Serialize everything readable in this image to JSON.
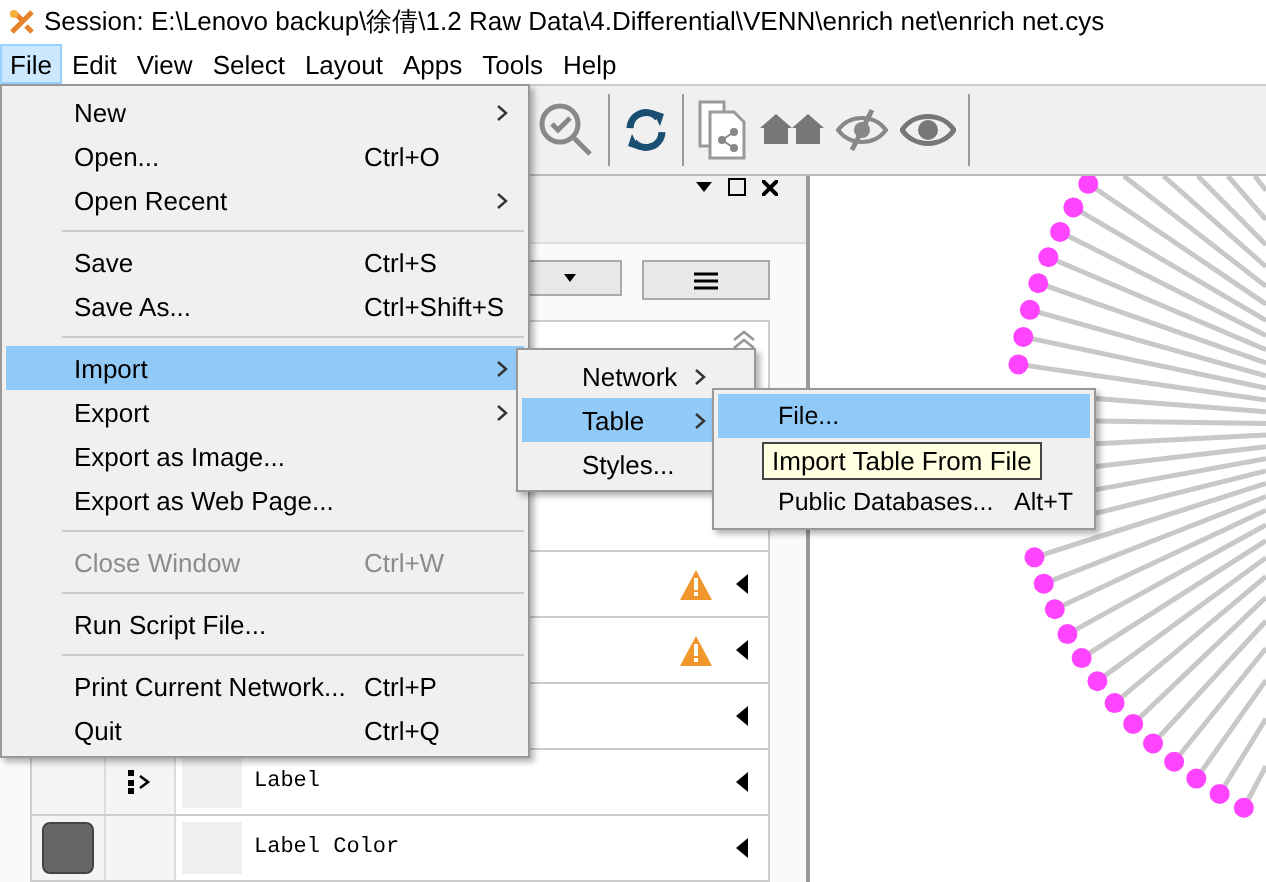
{
  "window": {
    "title": "Session: E:\\Lenovo backup\\徐倩\\1.2 Raw Data\\4.Differential\\VENN\\enrich net\\enrich net.cys"
  },
  "menubar": [
    {
      "label": "File",
      "selected": true
    },
    {
      "label": "Edit",
      "selected": false
    },
    {
      "label": "View",
      "selected": false
    },
    {
      "label": "Select",
      "selected": false
    },
    {
      "label": "Layout",
      "selected": false
    },
    {
      "label": "Apps",
      "selected": false
    },
    {
      "label": "Tools",
      "selected": false
    },
    {
      "label": "Help",
      "selected": false
    }
  ],
  "file_menu": {
    "groups": [
      [
        {
          "label": "New",
          "submenu": true,
          "selected": false,
          "disabled": false
        },
        {
          "label": "Open...",
          "shortcut": "Ctrl+O",
          "submenu": false,
          "selected": false,
          "disabled": false
        },
        {
          "label": "Open Recent",
          "submenu": true,
          "selected": false,
          "disabled": false
        }
      ],
      [
        {
          "label": "Save",
          "shortcut": "Ctrl+S",
          "submenu": false,
          "selected": false,
          "disabled": false
        },
        {
          "label": "Save As...",
          "shortcut": "Ctrl+Shift+S",
          "submenu": false,
          "selected": false,
          "disabled": false
        }
      ],
      [
        {
          "label": "Import",
          "submenu": true,
          "selected": true,
          "disabled": false
        },
        {
          "label": "Export",
          "submenu": true,
          "selected": false,
          "disabled": false
        },
        {
          "label": "Export as Image...",
          "submenu": false,
          "selected": false,
          "disabled": false
        },
        {
          "label": "Export as Web Page...",
          "submenu": false,
          "selected": false,
          "disabled": false
        }
      ],
      [
        {
          "label": "Close Window",
          "shortcut": "Ctrl+W",
          "submenu": false,
          "selected": false,
          "disabled": true
        }
      ],
      [
        {
          "label": "Run Script File...",
          "submenu": false,
          "selected": false,
          "disabled": false
        }
      ],
      [
        {
          "label": "Print Current Network...",
          "shortcut": "Ctrl+P",
          "submenu": false,
          "selected": false,
          "disabled": false
        },
        {
          "label": "Quit",
          "shortcut": "Ctrl+Q",
          "submenu": false,
          "selected": false,
          "disabled": false
        }
      ]
    ]
  },
  "import_menu": {
    "items": [
      {
        "label": "Network",
        "submenu": true,
        "selected": false
      },
      {
        "label": "Table",
        "submenu": true,
        "selected": true
      },
      {
        "label": "Styles...",
        "submenu": false,
        "selected": false
      }
    ]
  },
  "table_menu": {
    "items": [
      {
        "label": "File...",
        "selected": true
      },
      {
        "label": "Public Databases...",
        "shortcut": "Alt+T",
        "selected": false
      }
    ]
  },
  "tooltip": "Import Table From File",
  "style_rows": [
    {
      "kind": "plain",
      "warning": true
    },
    {
      "kind": "plain",
      "warning": true
    },
    {
      "kind": "plain",
      "warning": false
    },
    {
      "kind": "mapping",
      "label": "Label",
      "warning": false
    },
    {
      "kind": "swatch",
      "label": "Label Color",
      "warning": false
    }
  ]
}
